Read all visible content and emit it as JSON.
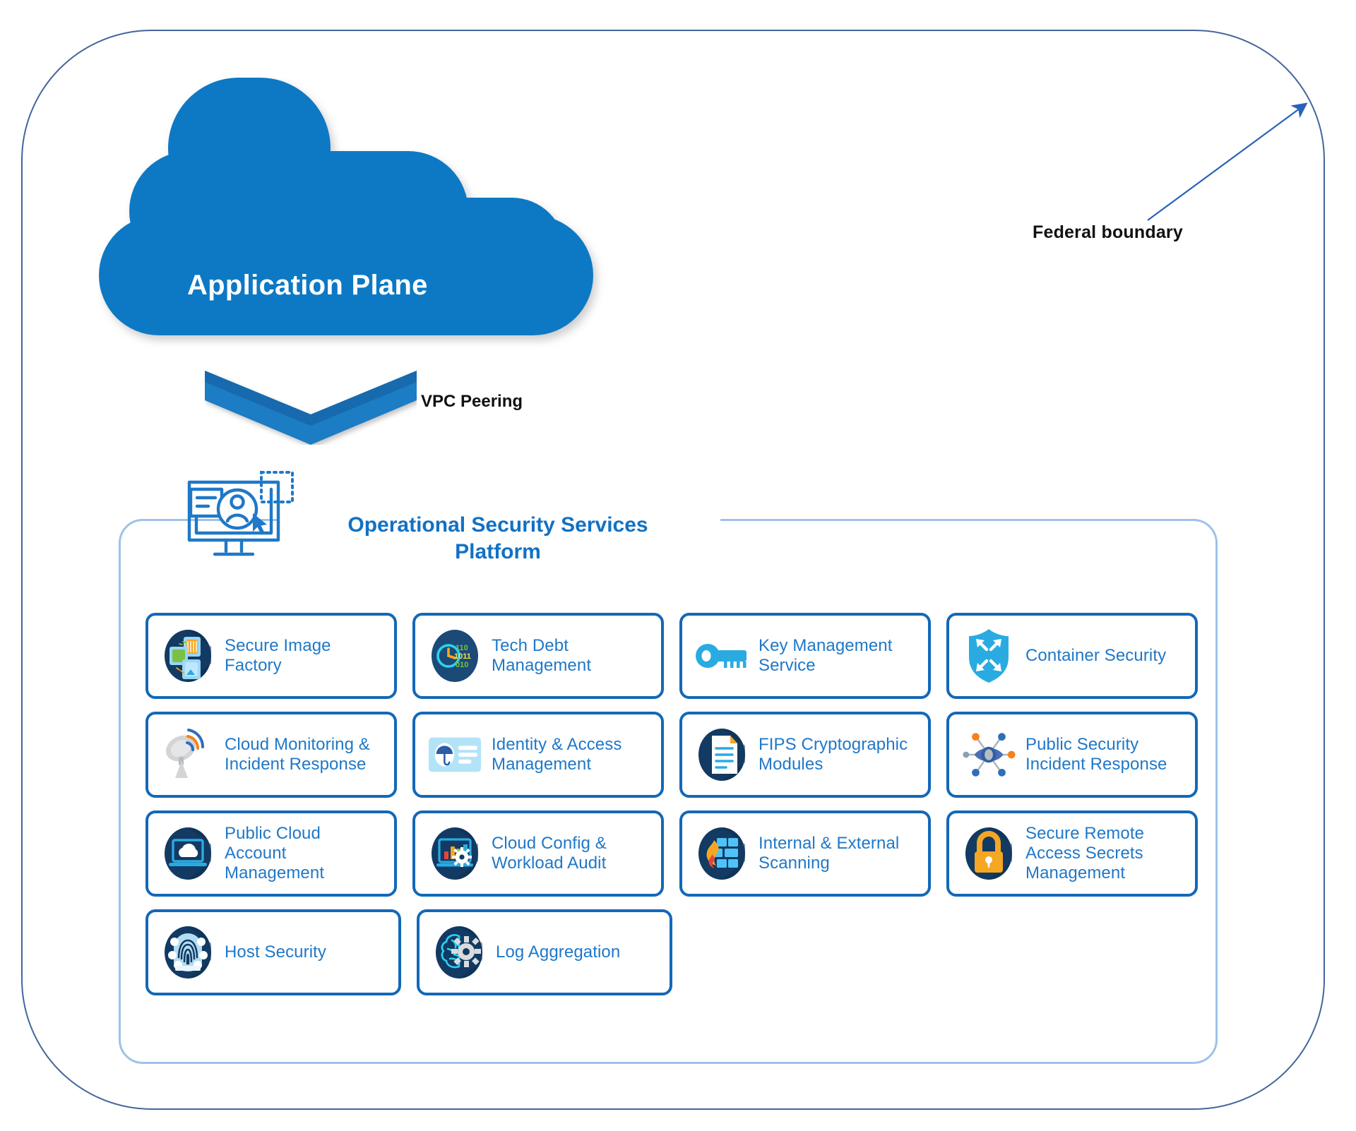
{
  "diagram": {
    "federal_boundary_label": "Federal boundary",
    "cloud_label": "Application Plane",
    "vpc_label": "VPC Peering",
    "platform_title": "Operational Security Services Platform",
    "platform_title_line1": "Operational Security Services",
    "platform_title_line2": "Platform"
  },
  "colors": {
    "cloud_blue": "#0f79c4",
    "card_border": "#1368b8",
    "card_text": "#1f78c8",
    "title_blue": "#1271c4",
    "boundary_line": "#44669c",
    "platform_line": "#9fc2e8",
    "icon_navy": "#123a63",
    "icon_light_blue": "#29abe2",
    "icon_orange": "#f5a623",
    "icon_green": "#7ac143"
  },
  "services": {
    "rows": [
      [
        {
          "label": "Secure Image Factory",
          "icon": "secure-image-factory-icon"
        },
        {
          "label": "Tech Debt Management",
          "icon": "tech-debt-clock-binary-icon"
        },
        {
          "label": "Key Management Service",
          "icon": "key-icon"
        },
        {
          "label": "Container Security",
          "icon": "shield-arrows-icon"
        }
      ],
      [
        {
          "label": "Cloud Monitoring & Incident Response",
          "icon": "satellite-dish-icon"
        },
        {
          "label": "Identity & Access Management",
          "icon": "id-card-umbrella-icon"
        },
        {
          "label": "FIPS Cryptographic Modules",
          "icon": "document-icon"
        },
        {
          "label": "Public Security Incident Response",
          "icon": "eye-network-icon"
        }
      ],
      [
        {
          "label": "Public Cloud Account Management",
          "icon": "laptop-cloud-icon"
        },
        {
          "label": "Cloud Config & Workload Audit",
          "icon": "chart-gear-icon"
        },
        {
          "label": "Internal & External Scanning",
          "icon": "firewall-flame-icon"
        },
        {
          "label": "Secure Remote Access Secrets Management",
          "icon": "padlock-icon"
        }
      ],
      [
        {
          "label": "Host Security",
          "icon": "fingerprint-gear-icon"
        },
        {
          "label": "Log Aggregation",
          "icon": "brain-gear-icon"
        }
      ]
    ]
  }
}
